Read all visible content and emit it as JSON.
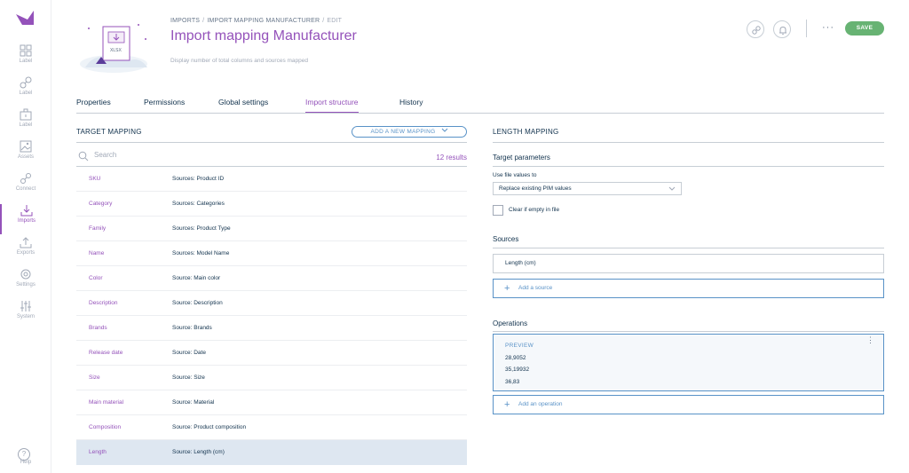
{
  "nav": {
    "items": [
      {
        "label": "Label",
        "icon": "grid-icon"
      },
      {
        "label": "Label",
        "icon": "link-icon"
      },
      {
        "label": "Label",
        "icon": "briefcase-icon"
      },
      {
        "label": "Assets",
        "icon": "image-icon"
      },
      {
        "label": "Connect",
        "icon": "plug-icon"
      },
      {
        "label": "Imports",
        "icon": "import-icon",
        "active": true
      },
      {
        "label": "Exports",
        "icon": "export-icon"
      },
      {
        "label": "Settings",
        "icon": "gear-icon"
      },
      {
        "label": "System",
        "icon": "sliders-icon"
      }
    ],
    "help": "Help",
    "help_glyph": "?"
  },
  "header": {
    "breadcrumb": [
      "IMPORTS",
      "IMPORT MAPPING MANUFACTURER",
      "EDIT"
    ],
    "breadcrumb_sep": "/",
    "title": "Import mapping Manufacturer",
    "subtitle": "Display number of total columns and sources mapped",
    "illustration_badge": "XLSX",
    "more": "···",
    "save": "SAVE"
  },
  "tabs": [
    "Properties",
    "Permissions",
    "Global settings",
    "Import structure",
    "History"
  ],
  "target_mapping": {
    "title": "TARGET MAPPING",
    "add_button": "ADD A NEW MAPPING",
    "search_placeholder": "Search",
    "results": "12 results",
    "rows": [
      {
        "attr": "SKU",
        "source": "Sources: Product ID"
      },
      {
        "attr": "Category",
        "source": "Sources: Categories"
      },
      {
        "attr": "Family",
        "source": "Sources: Product Type"
      },
      {
        "attr": "Name",
        "source": "Sources: Model Name"
      },
      {
        "attr": "Color",
        "source": "Source: Main color"
      },
      {
        "attr": "Description",
        "source": "Source: Description"
      },
      {
        "attr": "Brands",
        "source": "Source: Brands"
      },
      {
        "attr": "Release date",
        "source": "Source: Date"
      },
      {
        "attr": "Size",
        "source": "Source: Size"
      },
      {
        "attr": "Main material",
        "source": "Source: Material"
      },
      {
        "attr": "Composition",
        "source": "Source: Product composition"
      },
      {
        "attr": "Length",
        "source": "Source: Length (cm)",
        "selected": true
      }
    ]
  },
  "length_mapping": {
    "title": "LENGTH MAPPING",
    "target_parameters": "Target parameters",
    "use_file_values_label": "Use file values to",
    "use_file_values_selected": "Replace existing PIM values",
    "clear_if_empty": "Clear if empty in file",
    "sources_title": "Sources",
    "source_value": "Length (cm)",
    "add_source": "Add a source",
    "operations_title": "Operations",
    "preview_title": "PREVIEW",
    "preview_values": [
      "28,9052",
      "35,19932",
      "36,83"
    ],
    "kebab": "⋮",
    "add_operation": "Add an operation",
    "plus": "+"
  },
  "colors": {
    "accent": "#9452ba",
    "link": "#5992c7",
    "save": "#67b373",
    "selected_row": "#dee7f1"
  }
}
